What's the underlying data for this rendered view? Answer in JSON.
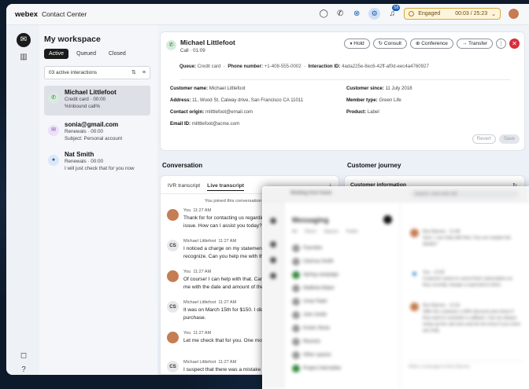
{
  "topbar": {
    "brand": "webex",
    "product": "Contact Center",
    "notif_count": "58",
    "state": "Engaged",
    "timer": "00:03 / 25:23"
  },
  "workspace": {
    "title": "My workspace",
    "tabs": [
      "Active",
      "Queued",
      "Closed"
    ],
    "active_count": "03 active interactions",
    "items": [
      {
        "name": "Michael Littlefoot",
        "line1": "Credit card · 00:00",
        "line2": "%Inbound call%",
        "channel": "phone",
        "color": "#1f7a36",
        "bg": "#d7ecdc"
      },
      {
        "name": "sonia@gmail.com",
        "line1": "Renewals · 00:00",
        "line2": "Subject: Personal account",
        "channel": "email",
        "color": "#7b3fb6",
        "bg": "#ece1f6"
      },
      {
        "name": "Nat Smith",
        "line1": "Renewals · 00:00",
        "line2": "I will just check that for you now",
        "channel": "chat",
        "color": "#1a5db8",
        "bg": "#dbe7f7"
      }
    ]
  },
  "contact": {
    "name": "Michael Littlefoot",
    "status": "Call · 01:09",
    "buttons": {
      "hold": "Hold",
      "consult": "Consult",
      "conference": "Conference",
      "transfer": "Transfer"
    },
    "info": {
      "queue_label": "Queue:",
      "queue": "Credit card",
      "phone_label": "Phone number:",
      "phone": "+1-408-555-0002",
      "interaction_label": "Interaction ID:",
      "interaction": "4ada225e-8ec6-42ff-af0d-eec4a4760927"
    },
    "fields": [
      {
        "label": "Customer name:",
        "value": "Michael Littlefoot"
      },
      {
        "label": "Address:",
        "value": "11, Wood St, Calway drive, San Francisco CA 11011"
      },
      {
        "label": "Contact origin:",
        "value": "mlittlefoot@email.com"
      },
      {
        "label": "Email ID:",
        "value": "mlittlefoot@acme.com"
      },
      {
        "label": "Customer since:",
        "value": "11 July 2018"
      },
      {
        "label": "Member type:",
        "value": "Green Life"
      },
      {
        "label": "Product:",
        "value": "Label"
      }
    ],
    "revert": "Revert",
    "save": "Save"
  },
  "conversation": {
    "title": "Conversation",
    "tabs": [
      "IVR transcript",
      "Live transcript"
    ],
    "joined": "You joined this conversation",
    "messages": [
      {
        "who": "You",
        "time": "11:27 AM",
        "lines": [
          "Thank for for contacting us regarding your",
          "issue. How can I assist you today?"
        ]
      },
      {
        "who": "Michael Littlefoot",
        "time": "11:27 AM",
        "lines": [
          "I noticed a charge on my statement I don't",
          "recognize. Can you help me with that?"
        ]
      },
      {
        "who": "You",
        "time": "11:27 AM",
        "lines": [
          "Of course! I can help with that. Can you provide",
          "me with the date and amount of the charge?"
        ]
      },
      {
        "who": "Michael Littlefoot",
        "time": "11:27 AM",
        "lines": [
          "It was on March 15th for $150. I didn't make that",
          "purchase."
        ]
      },
      {
        "who": "You",
        "time": "11:27 AM",
        "lines": [
          "Let me check that for you. One moment please."
        ]
      },
      {
        "who": "Michael Littlefoot",
        "time": "11:27 AM",
        "lines": [
          "I suspect that there was a mistake"
        ]
      }
    ]
  },
  "journey": {
    "title": "Customer journey",
    "panel": "Customer information"
  },
  "overlay": {
    "window_title": "Working from home",
    "search": "Search, meet and call",
    "heading": "Messaging",
    "filters": [
      "All",
      "Direct",
      "Spaces",
      "Public"
    ],
    "rows": [
      {
        "label": "Favorites",
        "green": false
      },
      {
        "label": "Clarissa Smith",
        "green": false
      },
      {
        "label": "Spring campaign",
        "green": true
      },
      {
        "label": "Matthew Baker",
        "green": false
      },
      {
        "label": "Umar Patel",
        "green": false
      },
      {
        "label": "John Smith",
        "green": false
      },
      {
        "label": "Kristin Stone",
        "green": false
      },
      {
        "label": "Recents",
        "green": false
      },
      {
        "label": "Other spaces",
        "green": false
      },
      {
        "label": "Project Interstellar",
        "green": true
      }
    ],
    "messages": [
      {
        "meta": "Ron Barnes · 11:48",
        "text": "Sure, I can help with that. Can you explain the details?"
      },
      {
        "meta": "You · 11:50",
        "text": "Customer wants to cancel their subscription as they recently change a expected to them"
      },
      {
        "meta": "Ron Barnes · 11:52",
        "text": "Offer the customer a 30% discount and check if they want to schedule a callback. Can we always setup up the call soon and let me know if you need any help"
      }
    ],
    "compose": "Write a message to Ron Barnes"
  }
}
